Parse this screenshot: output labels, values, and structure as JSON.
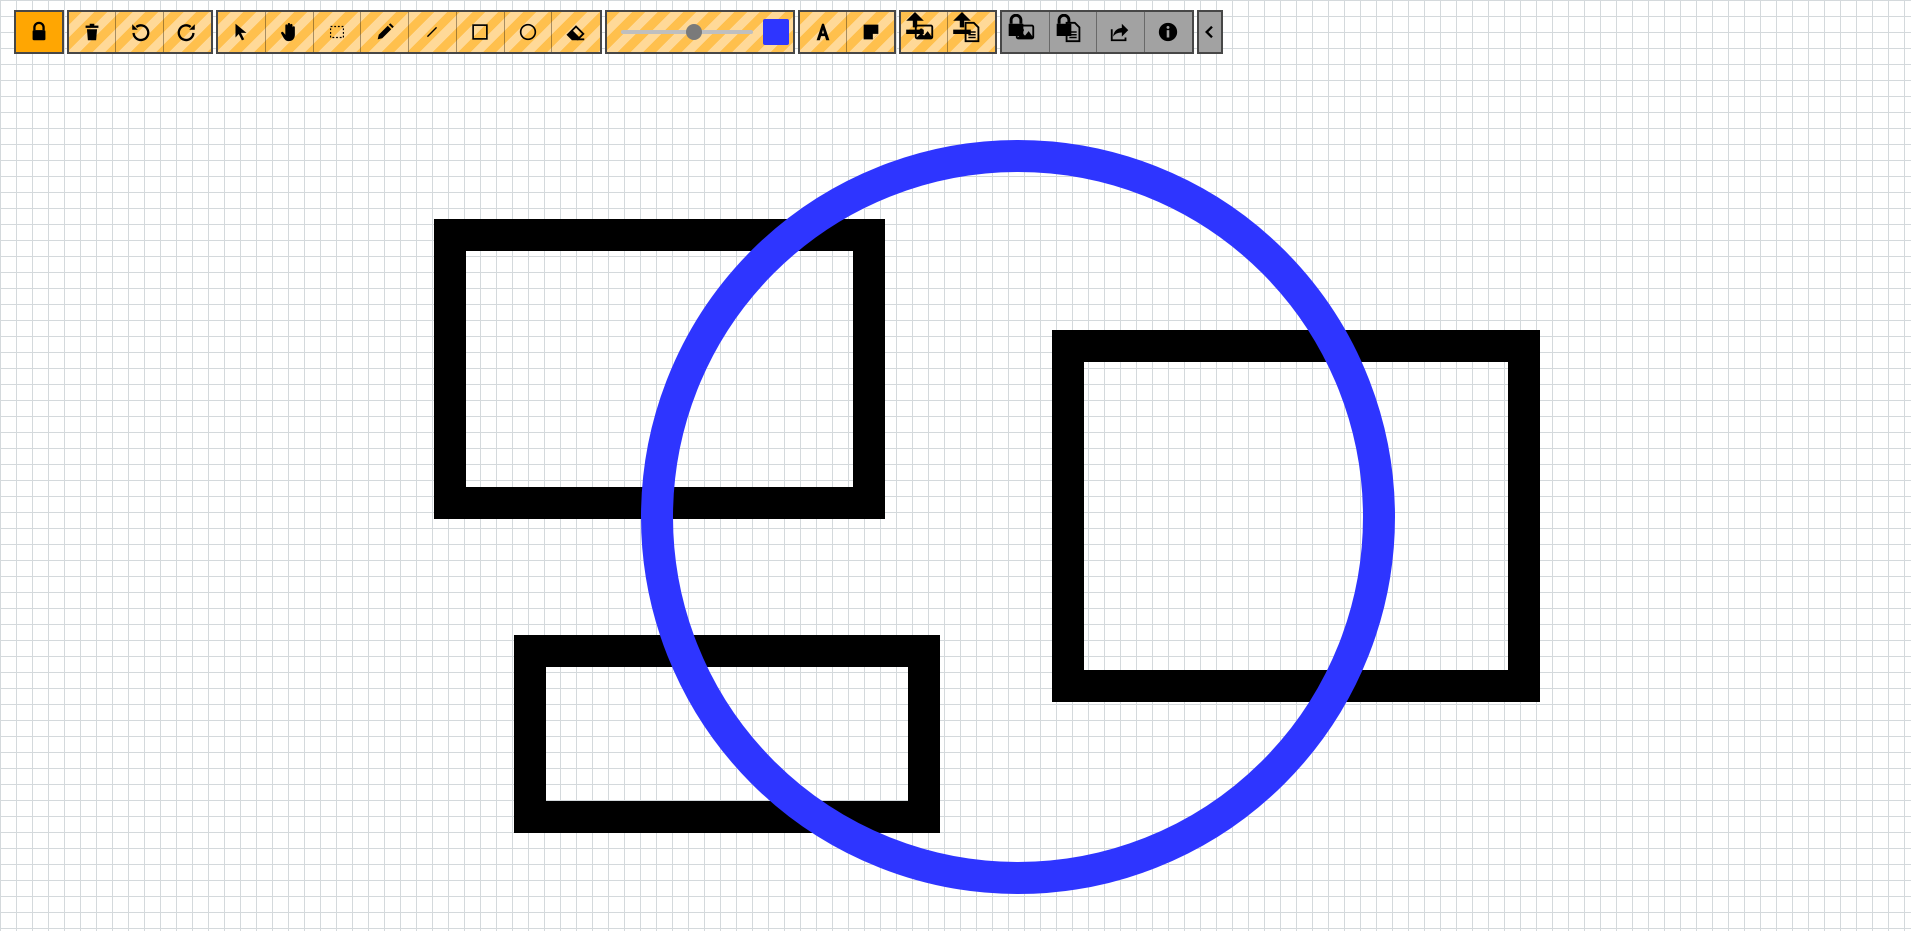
{
  "app": {
    "name": "whiteboard-canvas"
  },
  "toolbar": {
    "groups": [
      {
        "name": "lock",
        "tools": [
          {
            "id": "lock",
            "icon": "lock-icon",
            "active": true
          }
        ]
      },
      {
        "name": "history",
        "tools": [
          {
            "id": "clear",
            "icon": "trash-icon"
          },
          {
            "id": "undo",
            "icon": "undo-icon"
          },
          {
            "id": "redo",
            "icon": "redo-icon"
          }
        ]
      },
      {
        "name": "tools",
        "tools": [
          {
            "id": "select",
            "icon": "pointer-icon"
          },
          {
            "id": "pan",
            "icon": "hand-icon"
          },
          {
            "id": "area-select",
            "icon": "dashed-rect-icon"
          },
          {
            "id": "pencil",
            "icon": "pencil-icon"
          },
          {
            "id": "line",
            "icon": "line-icon"
          },
          {
            "id": "rectangle",
            "icon": "rectangle-icon"
          },
          {
            "id": "circle",
            "icon": "circle-icon"
          },
          {
            "id": "eraser",
            "icon": "eraser-icon"
          }
        ]
      },
      {
        "name": "style",
        "stroke_width_fraction": 0.55,
        "color": "#2e35ff"
      },
      {
        "name": "text",
        "tools": [
          {
            "id": "text",
            "icon": "text-A-icon"
          },
          {
            "id": "sticky-note",
            "icon": "sticky-note-icon"
          }
        ]
      },
      {
        "name": "upload",
        "tools": [
          {
            "id": "upload-image",
            "icon": "upload-image-icon"
          },
          {
            "id": "upload-pdf",
            "icon": "upload-document-icon"
          }
        ]
      },
      {
        "name": "share",
        "tools": [
          {
            "id": "save-image",
            "icon": "locked-image-icon"
          },
          {
            "id": "save-pdf",
            "icon": "locked-document-icon"
          },
          {
            "id": "share",
            "icon": "share-icon"
          },
          {
            "id": "info",
            "icon": "info-icon"
          }
        ]
      },
      {
        "name": "collapse",
        "tools": [
          {
            "id": "collapse",
            "icon": "chevron-left-icon"
          }
        ]
      }
    ]
  },
  "canvas": {
    "background": "#ffffff",
    "grid_color": "#d4d9dc",
    "shapes": [
      {
        "type": "rectangle",
        "name": "rect-top-left",
        "stroke": "#000000"
      },
      {
        "type": "rectangle",
        "name": "rect-right",
        "stroke": "#000000"
      },
      {
        "type": "rectangle",
        "name": "rect-bottom",
        "stroke": "#000000"
      },
      {
        "type": "circle",
        "name": "blue-circle",
        "stroke": "#2e35ff"
      }
    ]
  }
}
